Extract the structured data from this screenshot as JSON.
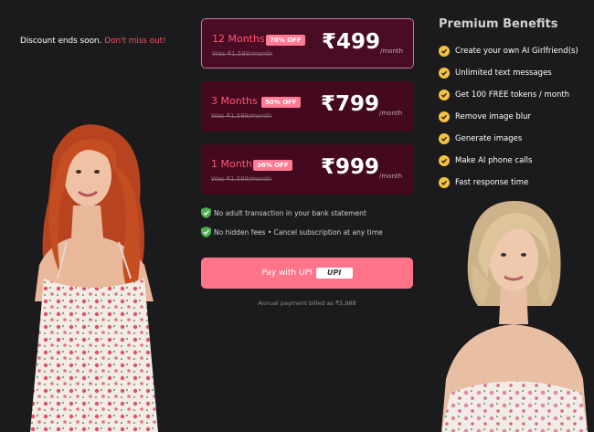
{
  "promo": {
    "text": "Discount ends soon.",
    "highlight": "Don't miss out!"
  },
  "plans": [
    {
      "name": "12 Months",
      "badge": "70% OFF",
      "was": "Was ₹1,599/month",
      "price": "₹499",
      "per": "/month",
      "selected": true
    },
    {
      "name": "3 Months",
      "badge": "50% OFF",
      "was": "Was ₹1,599/month",
      "price": "₹799",
      "per": "/month",
      "selected": false
    },
    {
      "name": "1 Month",
      "badge": "36% OFF",
      "was": "Was ₹1,599/month",
      "price": "₹999",
      "per": "/month",
      "selected": false
    }
  ],
  "assurances": [
    "No adult transaction in your bank statement",
    "No hidden fees • Cancel subscription at any time"
  ],
  "pay_button": {
    "label": "Pay with UPI",
    "logo": "UPI"
  },
  "billed_note": "Annual payment billed as ₹5,988",
  "benefits": {
    "title": "Premium Benefits",
    "items": [
      "Create your own AI Girlfriend(s)",
      "Unlimited text messages",
      "Get 100 FREE tokens / month",
      "Remove image blur",
      "Generate images",
      "Make AI phone calls",
      "Fast response time"
    ]
  },
  "colors": {
    "background": "#1b1b1d",
    "accent": "#ff7489",
    "plan_bg": "#44091f",
    "check": "#f5c242",
    "alert": "#ff4d5e"
  },
  "icons": {
    "assurance": "shield-check-icon",
    "benefit": "check-circle-icon"
  }
}
